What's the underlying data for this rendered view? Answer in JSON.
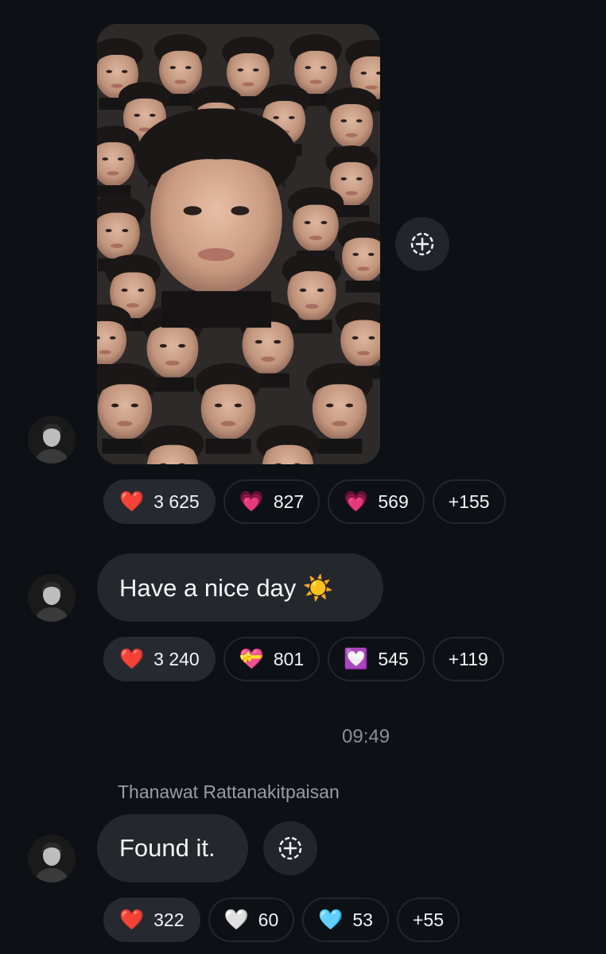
{
  "messages": [
    {
      "type": "image",
      "image_alt": "Collage of many repeated selfies of the same face with one large face in the upper center",
      "reactions": [
        {
          "emoji": "❤️",
          "count": "3 625",
          "active": true
        },
        {
          "emoji": "💗",
          "count": "827"
        },
        {
          "emoji": "💗",
          "count": "569"
        },
        {
          "emoji": "",
          "count": "+155"
        }
      ]
    },
    {
      "type": "text",
      "text": "Have a nice day ☀️",
      "reactions": [
        {
          "emoji": "❤️",
          "count": "3 240"
        },
        {
          "emoji": "💝",
          "count": "801"
        },
        {
          "emoji": "💟",
          "count": "545"
        },
        {
          "emoji": "",
          "count": "+119"
        }
      ]
    },
    {
      "type": "timestamp",
      "text": "09:49"
    },
    {
      "type": "text",
      "sender": "Thanawat Rattanakitpaisan",
      "text": "Found it.",
      "reactions": [
        {
          "emoji": "❤️",
          "count": "322",
          "active": true
        },
        {
          "emoji": "🤍",
          "count": "60"
        },
        {
          "emoji": "🩵",
          "count": "53"
        },
        {
          "emoji": "",
          "count": "+55"
        }
      ]
    }
  ],
  "icons": {
    "add_reaction": "add-reaction-icon",
    "avatar": "profile-avatar"
  },
  "colors": {
    "background": "#0d1014",
    "bubble": "#24272c",
    "pill_border": "#23272d",
    "muted_text": "#8b8f96"
  }
}
